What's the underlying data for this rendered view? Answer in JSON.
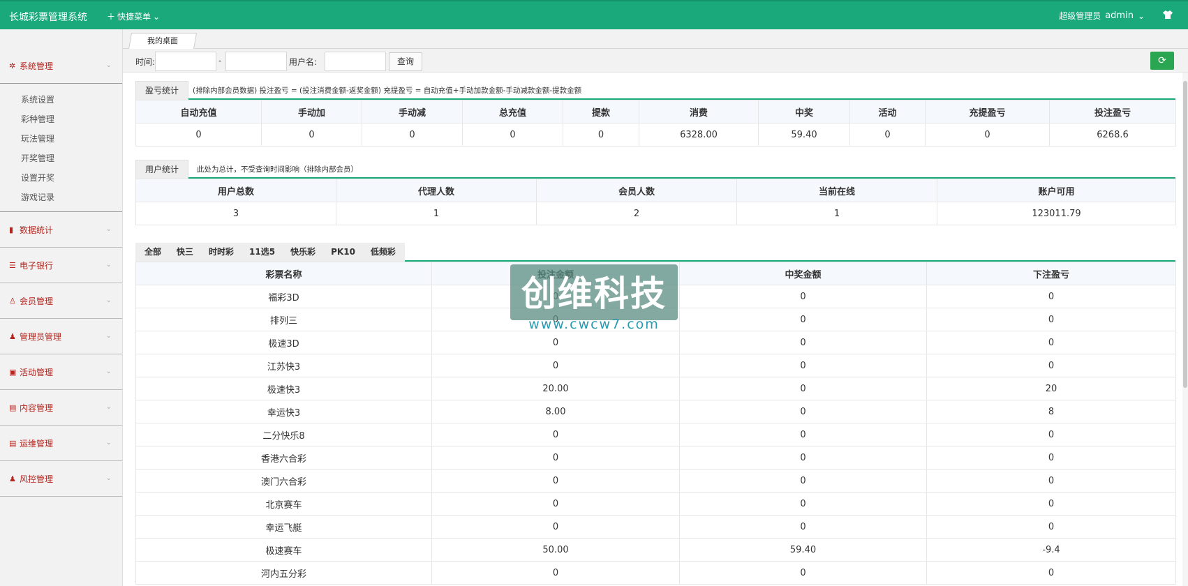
{
  "header": {
    "brand": "长城彩票管理系统",
    "quick_menu": "快捷菜单",
    "role": "超级管理员",
    "user": "admin"
  },
  "sidebar": {
    "groups": [
      {
        "label": "系统管理",
        "icon": "gear-icon"
      },
      {
        "label": "数据统计",
        "icon": "chart-icon"
      },
      {
        "label": "电子银行",
        "icon": "list-icon"
      },
      {
        "label": "会员管理",
        "icon": "user-outline-icon"
      },
      {
        "label": "管理员管理",
        "icon": "user-icon"
      },
      {
        "label": "活动管理",
        "icon": "gift-icon"
      },
      {
        "label": "内容管理",
        "icon": "book-icon"
      },
      {
        "label": "运维管理",
        "icon": "book-icon"
      },
      {
        "label": "风控管理",
        "icon": "user-icon"
      }
    ],
    "system_items": [
      "系统设置",
      "彩种管理",
      "玩法管理",
      "开奖管理",
      "设置开奖",
      "游戏记录"
    ]
  },
  "tabs": {
    "desk": "我的桌面"
  },
  "filter": {
    "time_label": "时间:",
    "dash": "-",
    "user_label": "用户名:",
    "query_button": "查询"
  },
  "profit": {
    "tab": "盈亏统计",
    "note": "(排除内部会员数据)  投注盈亏 = (投注消费金额-返奖金额)     充提盈亏 = 自动充值+手动加款金额-手动减款金额-提款金额",
    "headers": [
      "自动充值",
      "手动加",
      "手动减",
      "总充值",
      "提款",
      "消费",
      "中奖",
      "活动",
      "充提盈亏",
      "投注盈亏"
    ],
    "values": [
      "0",
      "0",
      "0",
      "0",
      "0",
      "6328.00",
      "59.40",
      "0",
      "0",
      "6268.6"
    ]
  },
  "users": {
    "tab": "用户统计",
    "note": "此处为总计，不受查询时间影响（排除内部会员）",
    "headers": [
      "用户总数",
      "代理人数",
      "会员人数",
      "当前在线",
      "账户可用"
    ],
    "values": [
      "3",
      "1",
      "2",
      "1",
      "123011.79"
    ]
  },
  "game_tabs": [
    "全部",
    "快三",
    "时时彩",
    "11选5",
    "快乐彩",
    "PK10",
    "低频彩"
  ],
  "lottery": {
    "headers": [
      "彩票名称",
      "投注金额",
      "中奖金额",
      "下注盈亏"
    ],
    "rows": [
      [
        "福彩3D",
        "0",
        "0",
        "0"
      ],
      [
        "排列三",
        "0",
        "0",
        "0"
      ],
      [
        "极速3D",
        "0",
        "0",
        "0"
      ],
      [
        "江苏快3",
        "0",
        "0",
        "0"
      ],
      [
        "极速快3",
        "20.00",
        "0",
        "20"
      ],
      [
        "幸运快3",
        "8.00",
        "0",
        "8"
      ],
      [
        "二分快乐8",
        "0",
        "0",
        "0"
      ],
      [
        "香港六合彩",
        "0",
        "0",
        "0"
      ],
      [
        "澳门六合彩",
        "0",
        "0",
        "0"
      ],
      [
        "北京赛车",
        "0",
        "0",
        "0"
      ],
      [
        "幸运飞艇",
        "0",
        "0",
        "0"
      ],
      [
        "极速赛车",
        "50.00",
        "59.40",
        "-9.4"
      ],
      [
        "河内五分彩",
        "0",
        "0",
        "0"
      ]
    ]
  },
  "watermark": {
    "title": "创维科技",
    "url": "www.cwcw7.com"
  },
  "colors": {
    "primary": "#1aa97b",
    "accent_red": "#b5261f",
    "refresh": "#2aa653"
  }
}
